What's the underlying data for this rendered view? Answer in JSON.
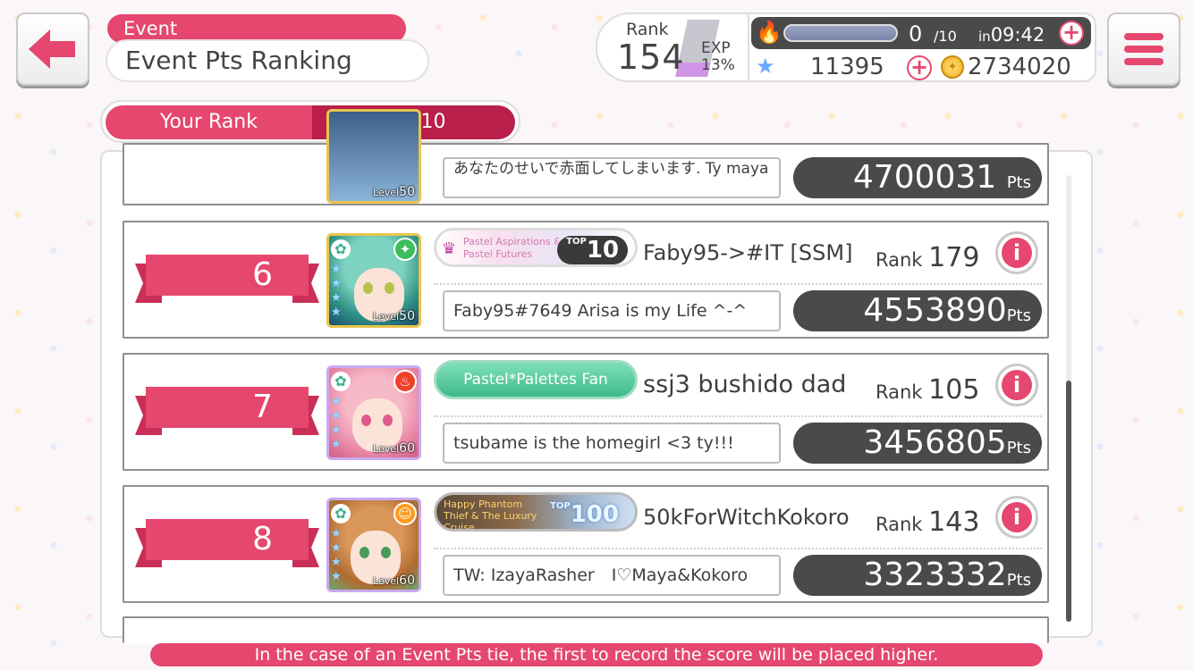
{
  "header": {
    "event_tag": "Event",
    "title": "Event Pts Ranking"
  },
  "status": {
    "rank_label": "Rank",
    "rank_value": "154",
    "exp_label": "EXP",
    "exp_percent": "13%",
    "energy_current": "0",
    "energy_max": "/10",
    "energy_timer_prefix": "in",
    "energy_timer": "09:42",
    "stars": "11395",
    "coins": "2734020"
  },
  "tabs": [
    {
      "label": "Your Rank",
      "active": false
    },
    {
      "label": "Top 10",
      "active": true
    }
  ],
  "partial_row": {
    "comment": "あなたのせいで赤面してしまいます. Ty maya",
    "points": "4700031",
    "level": "50"
  },
  "rows": [
    {
      "rank": "6",
      "card_level": "50",
      "title_badge_text": "Pastel Aspirations & Pastel Futures",
      "title_badge_top": "10",
      "player_name": "Faby95->#IT [SSM]",
      "player_rank": "179",
      "comment": "Faby95#7649 Arisa is my Life ^-^",
      "points": "4553890"
    },
    {
      "rank": "7",
      "card_level": "60",
      "title_badge_text": "Pastel*Palettes Fan",
      "player_name": "ssj3 bushido dad",
      "player_rank": "105",
      "comment": "tsubame is the homegirl <3 ty!!!",
      "points": "3456805"
    },
    {
      "rank": "8",
      "card_level": "60",
      "title_badge_text": "Happy Phantom Thief & The Luxury Cruise",
      "title_badge_top": "100",
      "player_name": "50kForWitchKokoro",
      "player_rank": "143",
      "comment": "TW: IzayaRasher　I♡Maya&Kokoro",
      "points": "3323332"
    }
  ],
  "labels": {
    "rank_prefix": "Rank",
    "pts_unit": "Pts",
    "level_prefix": "Level",
    "top_prefix": "TOP"
  },
  "footer_note": "In the case of an Event Pts tie, the first to record the score will be placed higher.",
  "colors": {
    "accent": "#e5476e",
    "accent_dark": "#b91f4a",
    "points_bg": "#4a4a4a"
  }
}
